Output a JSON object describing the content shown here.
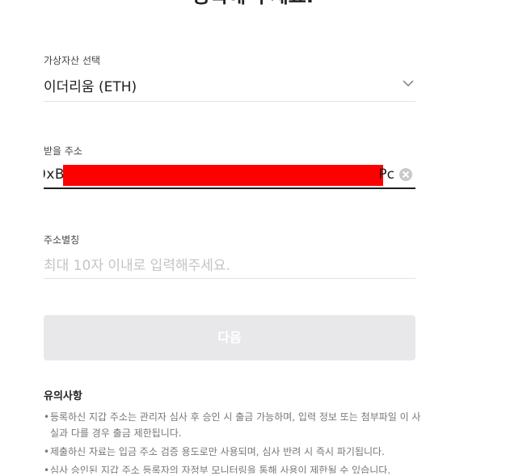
{
  "heading": "등록해 주세요.",
  "asset_field": {
    "label": "가상자산 선택",
    "value": "이더리움 (ETH)"
  },
  "address_field": {
    "label": "받을 주소",
    "value_start": "0xB",
    "value_end": "Pc"
  },
  "alias_field": {
    "label": "주소별칭",
    "placeholder": "최대 10자 이내로 입력해주세요."
  },
  "next_button": {
    "label": "다음",
    "enabled": false
  },
  "notice": {
    "title": "유의사항",
    "items": [
      "등록하신 지갑 주소는 관리자 심사 후 승인 시 출금 가능하며, 입력 정보 또는 첨부파일 이 사실과 다를 경우 출금 제한됩니다.",
      "제출하신 자료는 입금 주소 검증 용도로만 사용되며, 심사 반려 시 즉시 파기됩니다.",
      "심사 승인된 지갑 주소 등록자의 자정부 모니터링을 통해 사용이 제한될 수 있습니다."
    ]
  },
  "colors": {
    "redaction": "#ff0000",
    "button_disabled": "#e8e8eb",
    "underline_active": "#1e1e1e"
  }
}
